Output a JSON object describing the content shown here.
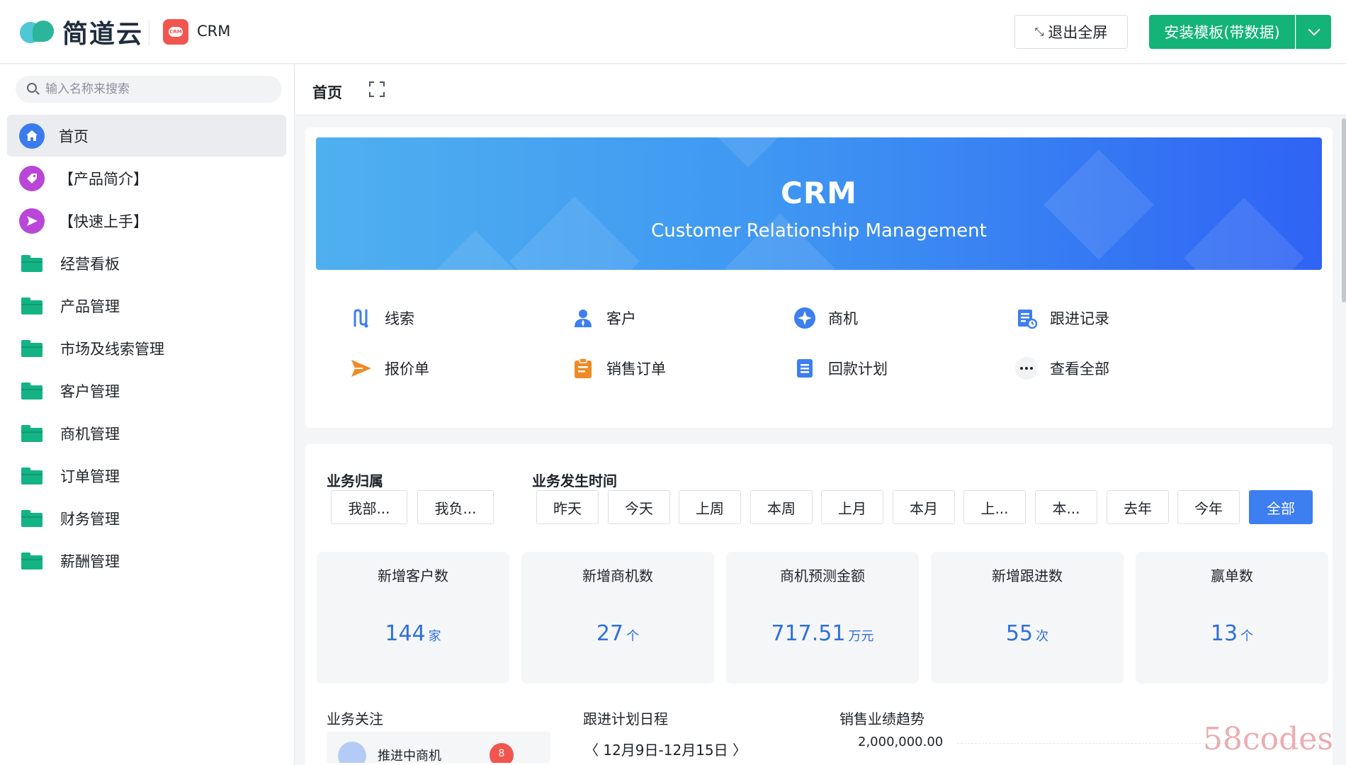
{
  "header": {
    "logo_text": "简道云",
    "app_name": "CRM",
    "app_icon_text": "CRM",
    "exit_fullscreen_label": "退出全屏",
    "install_label": "安装模板(带数据)",
    "accent_color": "#14b377"
  },
  "sidebar": {
    "search_placeholder": "输入名称来搜索",
    "items": [
      {
        "label": "首页",
        "icon": "home-icon"
      },
      {
        "label": "【产品简介】",
        "icon": "tag-icon"
      },
      {
        "label": "【快速上手】",
        "icon": "send-icon"
      },
      {
        "label": "经营看板",
        "icon": "folder-icon"
      },
      {
        "label": "产品管理",
        "icon": "folder-icon"
      },
      {
        "label": "市场及线索管理",
        "icon": "folder-icon"
      },
      {
        "label": "客户管理",
        "icon": "folder-icon"
      },
      {
        "label": "商机管理",
        "icon": "folder-icon"
      },
      {
        "label": "订单管理",
        "icon": "folder-icon"
      },
      {
        "label": "财务管理",
        "icon": "folder-icon"
      },
      {
        "label": "薪酬管理",
        "icon": "folder-icon"
      }
    ]
  },
  "tabs": {
    "home_label": "首页"
  },
  "banner": {
    "title": "CRM",
    "subtitle": "Customer Relationship Management"
  },
  "quick_links": [
    {
      "label": "线索",
      "icon": "clue-icon"
    },
    {
      "label": "客户",
      "icon": "customer-icon"
    },
    {
      "label": "商机",
      "icon": "opportunity-icon"
    },
    {
      "label": "跟进记录",
      "icon": "followup-icon"
    },
    {
      "label": "报价单",
      "icon": "quote-icon"
    },
    {
      "label": "销售订单",
      "icon": "order-icon"
    },
    {
      "label": "回款计划",
      "icon": "payment-icon"
    },
    {
      "label": "查看全部",
      "icon": "more-icon"
    }
  ],
  "filters": {
    "ownership_label": "业务归属",
    "ownership_options": [
      "我部...",
      "我负..."
    ],
    "time_label": "业务发生时间",
    "time_options": [
      "昨天",
      "今天",
      "上周",
      "本周",
      "上月",
      "本月",
      "上...",
      "本...",
      "去年",
      "今年",
      "全部"
    ],
    "selected_time": "全部"
  },
  "stats": [
    {
      "title": "新增客户数",
      "value": "144",
      "unit": "家"
    },
    {
      "title": "新增商机数",
      "value": "27",
      "unit": "个"
    },
    {
      "title": "商机预测金额",
      "value": "717.51",
      "unit": "万元"
    },
    {
      "title": "新增跟进数",
      "value": "55",
      "unit": "次"
    },
    {
      "title": "赢单数",
      "value": "13",
      "unit": "个"
    }
  ],
  "sections": {
    "focus_title": "业务关注",
    "focus_item_label": "推进中商机",
    "focus_item_badge": "8",
    "schedule_title": "跟进计划日程",
    "schedule_range": "〈 12月9日-12月15日 〉",
    "trend_title": "销售业绩趋势",
    "trend_axis_top": "2,000,000.00"
  },
  "watermark": "58codes"
}
